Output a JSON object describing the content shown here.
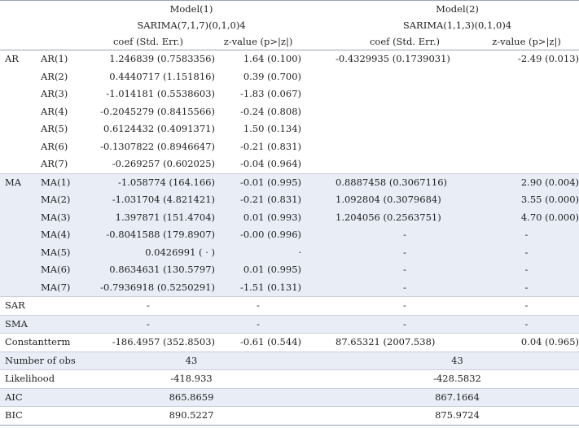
{
  "header": {
    "model1_title": "Model(1)",
    "model1_spec": "SARIMA(7,1,7)(0,1,0)4",
    "model2_title": "Model(2)",
    "model2_spec": "SARIMA(1,1,3)(0,1,0)4",
    "coef_label": "coef (Std. Err.)",
    "z_label": "z-value (p>|z|)"
  },
  "groups": [
    {
      "name": "AR",
      "shaded": false,
      "rows": [
        {
          "term": "AR(1)",
          "m1c": "1.246839 (0.7583356)",
          "m1z": "1.64 (0.100)",
          "m2c": "-0.4329935 (0.1739031)",
          "m2z": "-2.49 (0.013)"
        },
        {
          "term": "AR(2)",
          "m1c": "0.4440717 (1.151816)",
          "m1z": "0.39 (0.700)",
          "m2c": "",
          "m2z": ""
        },
        {
          "term": "AR(3)",
          "m1c": "-1.014181 (0.5538603)",
          "m1z": "-1.83 (0.067)",
          "m2c": "",
          "m2z": ""
        },
        {
          "term": "AR(4)",
          "m1c": "-0.2045279 (0.8415566)",
          "m1z": "-0.24 (0.808)",
          "m2c": "",
          "m2z": ""
        },
        {
          "term": "AR(5)",
          "m1c": "0.6124432 (0.4091371)",
          "m1z": "1.50 (0.134)",
          "m2c": "",
          "m2z": ""
        },
        {
          "term": "AR(6)",
          "m1c": "-0.1307822 (0.8946647)",
          "m1z": "-0.21 (0.831)",
          "m2c": "",
          "m2z": ""
        },
        {
          "term": "AR(7)",
          "m1c": "-0.269257 (0.602025)",
          "m1z": "-0.04 (0.964)",
          "m2c": "",
          "m2z": ""
        }
      ]
    },
    {
      "name": "MA",
      "shaded": true,
      "rows": [
        {
          "term": "MA(1)",
          "m1c": "-1.058774 (164.166)",
          "m1z": "-0.01 (0.995)",
          "m2c": "0.8887458 (0.3067116)",
          "m2z": "2.90 (0.004)"
        },
        {
          "term": "MA(2)",
          "m1c": "-1.031704 (4.821421)",
          "m1z": "-0.21 (0.831)",
          "m2c": "1.092804 (0.3079684)",
          "m2z": "3.55 (0.000)"
        },
        {
          "term": "MA(3)",
          "m1c": "1.397871 (151.4704)",
          "m1z": "0.01 (0.993)",
          "m2c": "1.204056 (0.2563751)",
          "m2z": "4.70 (0.000)"
        },
        {
          "term": "MA(4)",
          "m1c": "-0.8041588 (179.8907)",
          "m1z": "-0.00 (0.996)",
          "m2c": "-",
          "m2z": "-"
        },
        {
          "term": "MA(5)",
          "m1c": "0.0426991 ( · )",
          "m1z": "·",
          "m2c": "-",
          "m2z": "-"
        },
        {
          "term": "MA(6)",
          "m1c": "0.8634631 (130.5797)",
          "m1z": "0.01 (0.995)",
          "m2c": "-",
          "m2z": "-"
        },
        {
          "term": "MA(7)",
          "m1c": "-0.7936918 (0.5250291)",
          "m1z": "-1.51 (0.131)",
          "m2c": "-",
          "m2z": "-"
        }
      ]
    }
  ],
  "single_rows": [
    {
      "name": "SAR",
      "m1c": "-",
      "m1z": "-",
      "m2c": "-",
      "m2z": "-",
      "shaded": false
    },
    {
      "name": "SMA",
      "m1c": "-",
      "m1z": "-",
      "m2c": "-",
      "m2z": "-",
      "shaded": true
    },
    {
      "name": "Constantterm",
      "m1c": "-186.4957 (352.8503)",
      "m1z": "-0.61 (0.544)",
      "m2c": "87.65321 (2007.538)",
      "m2z": "0.04 (0.965)",
      "shaded": false
    }
  ],
  "stats": [
    {
      "name": "Number of obs",
      "m1": "43",
      "m2": "43",
      "shaded": true
    },
    {
      "name": "Likelihood",
      "m1": "-418.933",
      "m2": "-428.5832",
      "shaded": false
    },
    {
      "name": "AIC",
      "m1": "865.8659",
      "m2": "867.1664",
      "shaded": true
    },
    {
      "name": "BIC",
      "m1": "890.5227",
      "m2": "875.9724",
      "shaded": false
    }
  ]
}
